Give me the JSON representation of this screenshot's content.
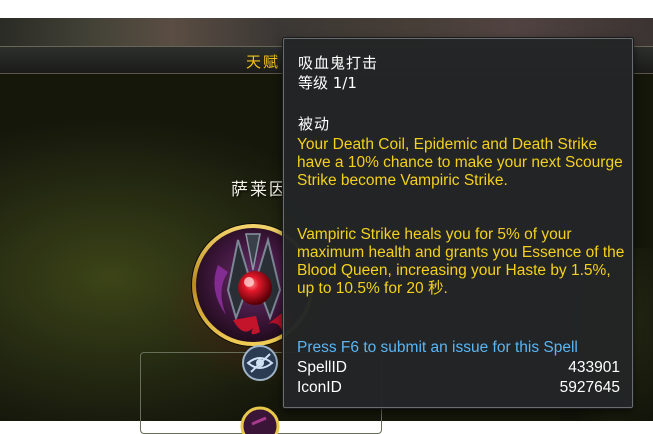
{
  "header": {
    "title": "天赋"
  },
  "talent_node": {
    "label": "萨莱因"
  },
  "tooltip": {
    "spell_name": "吸血鬼打击",
    "rank": "等级 1/1",
    "type": "被动",
    "description_1": "Your Death Coil, Epidemic and Death Strike have a 10% chance to make your next Scourge Strike become Vampiric Strike.",
    "description_2": "Vampiric Strike heals you for 5% of your maximum health and grants you Essence of the Blood Queen, increasing your Haste by 1.5%, up to 10.5% for 20 秒.",
    "press_hint": "Press F6 to submit an issue for this Spell",
    "spell_id_label": "SpellID",
    "spell_id_value": "433901",
    "icon_id_label": "IconID",
    "icon_id_value": "5927645"
  },
  "colors": {
    "tooltip_bg": "#232526",
    "title_text": "#ffffff",
    "description_text": "#f4d11d",
    "hint_text": "#5bb6f4",
    "header_gold": "#f2c417"
  },
  "icons": [
    "vampiric-strike-talent-icon",
    "eye-icon",
    "talent-ring-icon"
  ]
}
